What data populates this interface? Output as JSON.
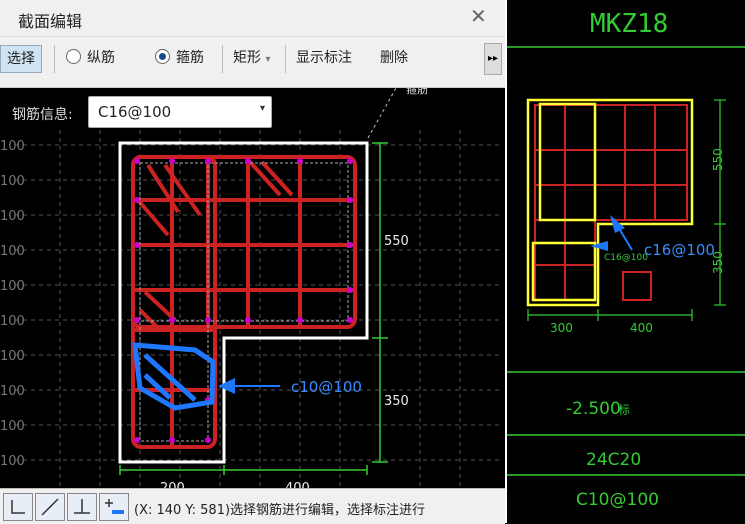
{
  "dialog": {
    "title": "截面编辑",
    "close_glyph": "✕",
    "toolbar": {
      "select": "选择",
      "longitudinal": "纵筋",
      "stirrup": "箍筋",
      "shape": "矩形",
      "shape_arrow": "▾",
      "show_label": "显示标注",
      "delete": "删除",
      "more": "▸▸"
    },
    "info_label": "钢筋信息:",
    "info_value": "C16@100",
    "dim_550": "550",
    "dim_350": "350",
    "dim_200": "200",
    "dim_400": "400",
    "grid_label": "100",
    "clipped_top_labels": [
      "箍筋",
      "核载"
    ],
    "annotation_left": "c10@100",
    "status": "(X: 140 Y: 581)选择钢筋进行编辑，选择标注进行"
  },
  "right": {
    "title": "MKZ18",
    "dim_550": "550",
    "dim_350": "350",
    "dim_300": "300",
    "dim_400": "400",
    "small_label": "C16@100",
    "annotation": "c16@100",
    "elevation": "-2.500",
    "elevation_suffix": "标",
    "main_bars": "24C20",
    "stirrup": "C10@100"
  },
  "colors": {
    "rebar": "#cc2222",
    "outline": "#ffffff",
    "dim": "#33cc33",
    "highlight": "#ffff33",
    "annotation": "#1e78ff",
    "node": "#cc00cc"
  }
}
